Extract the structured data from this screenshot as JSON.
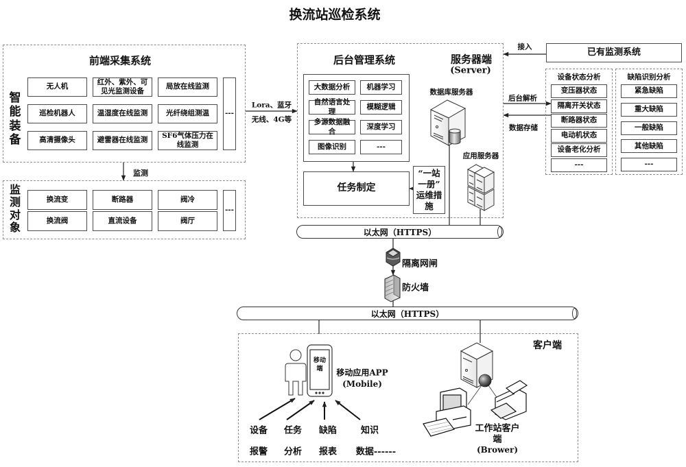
{
  "title": "换流站巡检系统",
  "frontend": {
    "title": "前端采集系统",
    "side_label": "智能装备",
    "items": [
      "无人机",
      "红外、紫外、可见光监测设备",
      "局放在线监测",
      "巡检机器人",
      "温湿度在线监测",
      "光纤绕组测温",
      "高清摄像头",
      "避雷器在线监测",
      "SF6气体压力在线监测"
    ],
    "more": "---"
  },
  "monitor_link_label": "监测",
  "monitor": {
    "side_label": "监测对象",
    "items": [
      "换流变",
      "断路器",
      "阀冷",
      "换流阀",
      "直流设备",
      "阀厅"
    ],
    "more": "---"
  },
  "link": {
    "line1": "Lora、蓝牙",
    "line2": "无线、4G等"
  },
  "backend": {
    "title": "后台管理系统",
    "algorithms": [
      "大数据分析",
      "机器学习",
      "自然语言处理",
      "模糊逻辑",
      "多源数据融合",
      "深度学习",
      "图像识别",
      "---"
    ],
    "task": "任务制定",
    "ops_lines": [
      "“一站",
      "一册”",
      "运维措",
      "施"
    ]
  },
  "server": {
    "title": "服务器端",
    "subtitle": "(Server)",
    "db_label": "数据库服务器",
    "app_label": "应用服务器"
  },
  "existing": {
    "title": "已有监测系统",
    "access_label": "接入"
  },
  "parse_label": "后台解析",
  "store_label": "数据存储",
  "device_analysis": {
    "title": "设备状态分析",
    "items": [
      "变压器状态",
      "隔离开关状态",
      "断路器状态",
      "电动机状态",
      "设备老化分析",
      "---"
    ]
  },
  "defect_analysis": {
    "title": "缺陷识别分析",
    "items": [
      "紧急缺陷",
      "重大缺陷",
      "一般缺陷",
      "其他缺陷",
      "---"
    ]
  },
  "network": {
    "top": "以太网（HTTPS）",
    "gateway": "隔离网闸",
    "firewall": "防火墙",
    "bottom": "以太网（HTTPS）"
  },
  "client": {
    "title": "客户端",
    "mobile_screen": "移动端",
    "mobile_label": "移动应用APP",
    "mobile_sub": "(Mobile)",
    "functions": [
      {
        "l1": "设备",
        "l2": "报警"
      },
      {
        "l1": "任务",
        "l2": "分析"
      },
      {
        "l1": "缺陷",
        "l2": "报表"
      },
      {
        "l1": "知识",
        "l2": "数据------"
      }
    ],
    "workstation_lines": [
      "工作站客户",
      "端"
    ],
    "workstation_sub": "(Brower)"
  }
}
